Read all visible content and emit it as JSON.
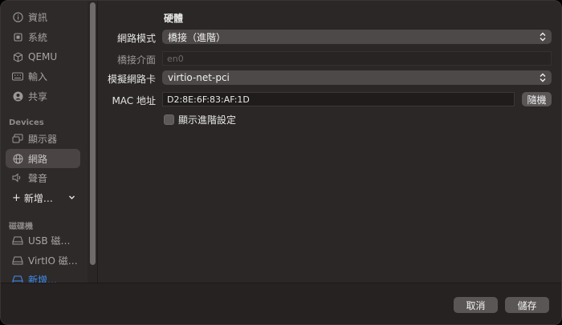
{
  "sidebar": {
    "items_top": [
      {
        "label": "資訊",
        "icon": "info-icon"
      },
      {
        "label": "系統",
        "icon": "cpu-icon"
      },
      {
        "label": "QEMU",
        "icon": "cube-icon"
      },
      {
        "label": "輸入",
        "icon": "keyboard-icon"
      },
      {
        "label": "共享",
        "icon": "person-icon"
      }
    ],
    "devices_section": "Devices",
    "items_devices": [
      {
        "label": "顯示器",
        "icon": "display-icon"
      },
      {
        "label": "網路",
        "icon": "globe-icon"
      },
      {
        "label": "聲音",
        "icon": "speaker-icon"
      }
    ],
    "add_device": "新增…",
    "drives_section": "磁碟機",
    "items_drives": [
      {
        "label": "USB 磁…",
        "icon": "drive-icon"
      },
      {
        "label": "VirtIO 磁…",
        "icon": "drive-icon"
      }
    ],
    "add_drive": "新增…"
  },
  "form": {
    "section_title": "硬體",
    "network_mode_label": "網路模式",
    "network_mode_value": "橋接（進階）",
    "bridge_interface_label": "橋接介面",
    "bridge_interface_placeholder": "en0",
    "emulated_card_label": "模擬網路卡",
    "emulated_card_value": "virtio-net-pci",
    "mac_label": "MAC 地址",
    "mac_value": "D2:8E:6F:83:AF:1D",
    "random_button": "隨機",
    "advanced_checkbox": "顯示進階設定"
  },
  "footer": {
    "cancel": "取消",
    "save": "儲存"
  }
}
